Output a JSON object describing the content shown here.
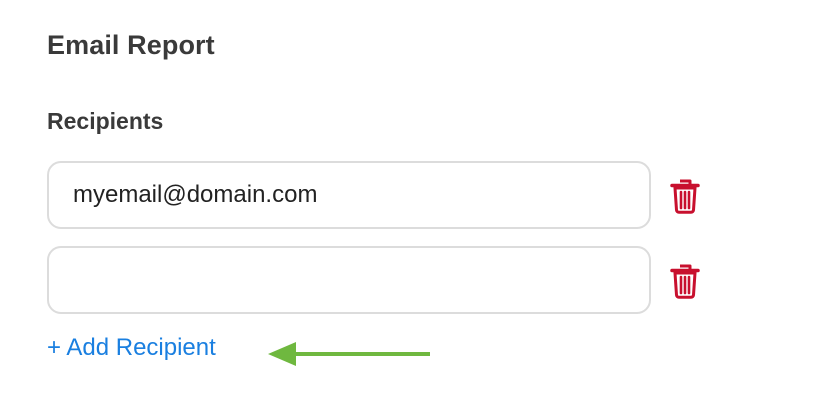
{
  "section": {
    "title": "Email Report"
  },
  "recipients": {
    "label": "Recipients",
    "rows": [
      {
        "value": "myemail@domain.com",
        "placeholder": "",
        "delete_icon": "trash-icon"
      },
      {
        "value": "",
        "placeholder": "",
        "delete_icon": "trash-icon"
      }
    ],
    "add_label": "+ Add Recipient"
  },
  "colors": {
    "heading": "#3a3a3a",
    "link": "#1a7fe0",
    "delete": "#c8102e",
    "input_border": "#dcdcdc",
    "annotation_arrow": "#6fb83f"
  }
}
